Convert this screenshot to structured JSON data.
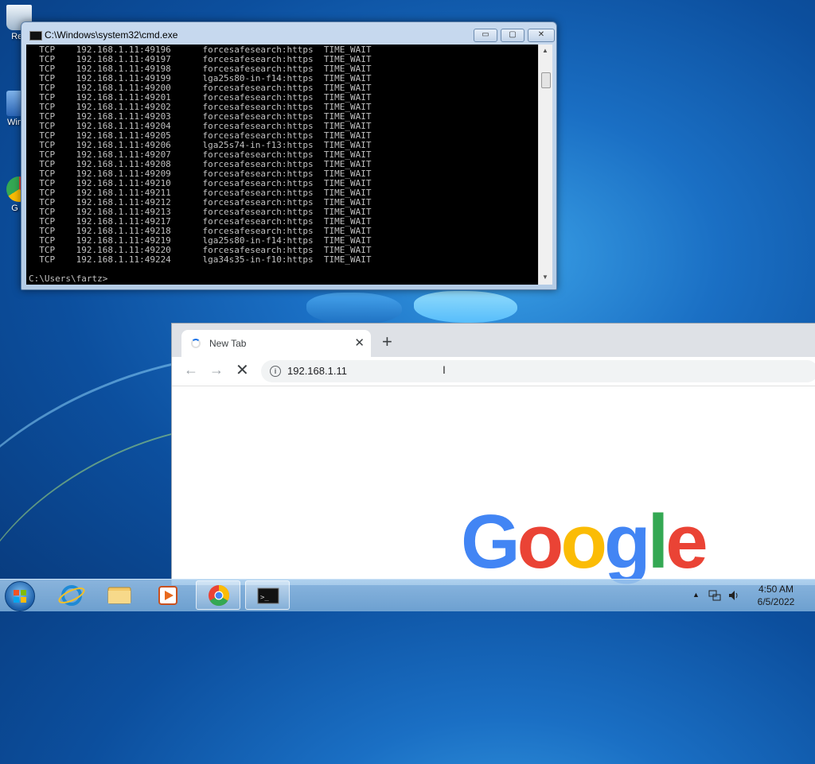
{
  "desktop": {
    "icons": [
      {
        "name": "recycle-bin",
        "label": "Rec"
      },
      {
        "name": "windows-update",
        "label": "Win U"
      },
      {
        "name": "google-chrome",
        "label": "G C"
      }
    ]
  },
  "cmd": {
    "title": "C:\\Windows\\system32\\cmd.exe",
    "lines": [
      "  TCP    192.168.1.11:49196      forcesafesearch:https  TIME_WAIT",
      "  TCP    192.168.1.11:49197      forcesafesearch:https  TIME_WAIT",
      "  TCP    192.168.1.11:49198      forcesafesearch:https  TIME_WAIT",
      "  TCP    192.168.1.11:49199      lga25s80-in-f14:https  TIME_WAIT",
      "  TCP    192.168.1.11:49200      forcesafesearch:https  TIME_WAIT",
      "  TCP    192.168.1.11:49201      forcesafesearch:https  TIME_WAIT",
      "  TCP    192.168.1.11:49202      forcesafesearch:https  TIME_WAIT",
      "  TCP    192.168.1.11:49203      forcesafesearch:https  TIME_WAIT",
      "  TCP    192.168.1.11:49204      forcesafesearch:https  TIME_WAIT",
      "  TCP    192.168.1.11:49205      forcesafesearch:https  TIME_WAIT",
      "  TCP    192.168.1.11:49206      lga25s74-in-f13:https  TIME_WAIT",
      "  TCP    192.168.1.11:49207      forcesafesearch:https  TIME_WAIT",
      "  TCP    192.168.1.11:49208      forcesafesearch:https  TIME_WAIT",
      "  TCP    192.168.1.11:49209      forcesafesearch:https  TIME_WAIT",
      "  TCP    192.168.1.11:49210      forcesafesearch:https  TIME_WAIT",
      "  TCP    192.168.1.11:49211      forcesafesearch:https  TIME_WAIT",
      "  TCP    192.168.1.11:49212      forcesafesearch:https  TIME_WAIT",
      "  TCP    192.168.1.11:49213      forcesafesearch:https  TIME_WAIT",
      "  TCP    192.168.1.11:49217      forcesafesearch:https  TIME_WAIT",
      "  TCP    192.168.1.11:49218      forcesafesearch:https  TIME_WAIT",
      "  TCP    192.168.1.11:49219      lga25s80-in-f14:https  TIME_WAIT",
      "  TCP    192.168.1.11:49220      forcesafesearch:https  TIME_WAIT",
      "  TCP    192.168.1.11:49224      lga34s35-in-f10:https  TIME_WAIT"
    ],
    "prompt": "C:\\Users\\fartz>",
    "buttons": {
      "minimize": "▭",
      "maximize": "▢",
      "close": "✕"
    }
  },
  "chrome": {
    "tab_title": "New Tab",
    "tab_close": "✕",
    "new_tab": "+",
    "back": "←",
    "forward": "→",
    "stop": "✕",
    "url": "192.168.1.11",
    "google_letters": [
      {
        "ch": "G",
        "color": "#4285F4"
      },
      {
        "ch": "o",
        "color": "#EA4335"
      },
      {
        "ch": "o",
        "color": "#FBBC05"
      },
      {
        "ch": "g",
        "color": "#4285F4"
      },
      {
        "ch": "l",
        "color": "#34A853"
      },
      {
        "ch": "e",
        "color": "#EA4335"
      }
    ]
  },
  "taskbar": {
    "apps": [
      "internet-explorer",
      "file-explorer",
      "media-player",
      "chrome",
      "command-prompt"
    ],
    "tray_arrow": "▲",
    "time": "4:50 AM",
    "date": "6/5/2022"
  }
}
